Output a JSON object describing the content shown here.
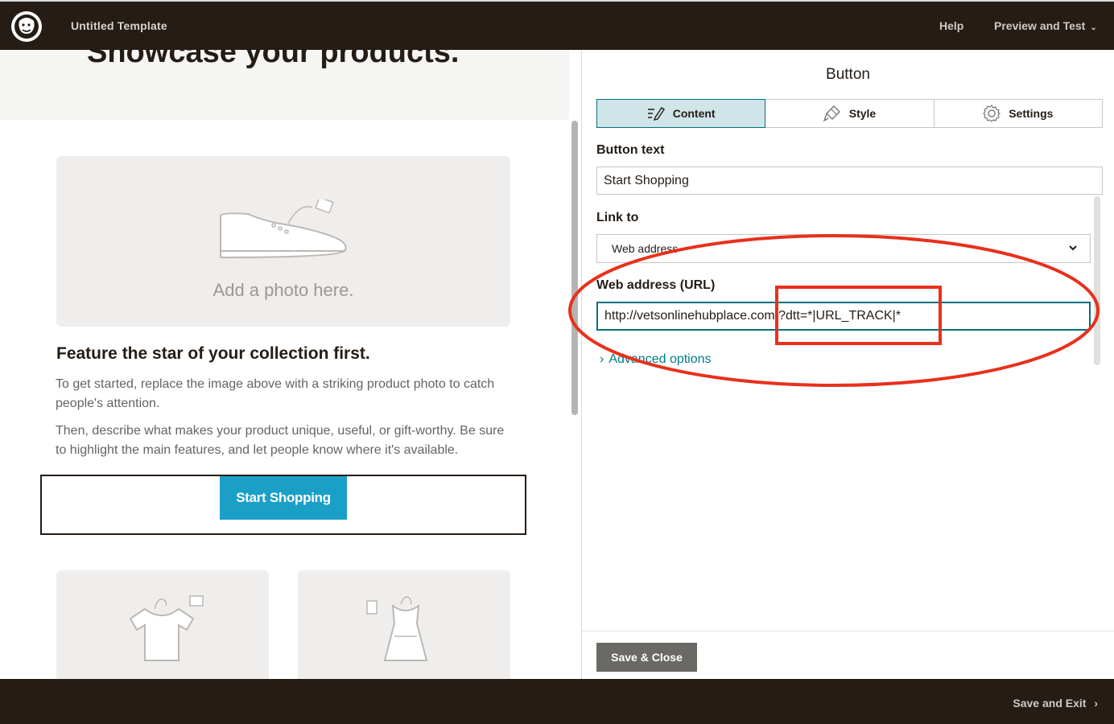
{
  "header": {
    "title": "Untitled Template",
    "help": "Help",
    "preview": "Preview and Test",
    "logo_icon": "mailchimp-freddie-icon"
  },
  "canvas": {
    "headline": "Showcase your products.",
    "photo_placeholder": "Add a photo here.",
    "feature_title": "Feature the star of your collection first.",
    "paragraph1": "To get started, replace the image above with a striking product photo to catch people's attention.",
    "paragraph2": "Then, describe what makes your product unique, useful, or gift-worthy. Be sure to highlight the main features, and let people know where it's available.",
    "button_label": "Start Shopping",
    "button_color": "#1a9fc7"
  },
  "panel": {
    "title": "Button",
    "tabs": [
      {
        "label": "Content",
        "icon": "pencil-lines-icon",
        "active": true
      },
      {
        "label": "Style",
        "icon": "paint-brush-icon",
        "active": false
      },
      {
        "label": "Settings",
        "icon": "gear-icon",
        "active": false
      }
    ],
    "button_text_label": "Button text",
    "button_text_value": "Start Shopping",
    "link_to_label": "Link to",
    "link_to_value": "Web address",
    "url_label": "Web address (URL)",
    "url_value": "http://vetsonlinehubplace.com/?dtt=*|URL_TRACK|*",
    "advanced": "Advanced options",
    "save_close": "Save & Close",
    "accent_color": "#007c89"
  },
  "footer": {
    "save_exit": "Save and Exit"
  },
  "annotation_color": "#e8301c"
}
